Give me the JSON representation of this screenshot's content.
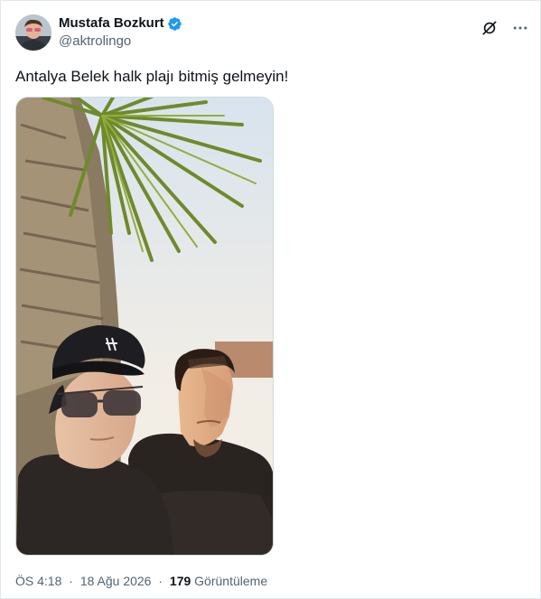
{
  "tweet": {
    "author": {
      "display_name": "Mustafa Bozkurt",
      "handle": "@aktrolingo",
      "verified": true,
      "verified_color": "#1d9bf0"
    },
    "text": "Antalya Belek halk plajı bitmiş gelmeyin!",
    "meta": {
      "time": "ÖS 4:18",
      "date": "18 Ağu 2026",
      "views_count": "179",
      "views_label": "Görüntüleme",
      "separator": "·"
    },
    "icons": [
      "verified-badge-icon",
      "grok-icon",
      "more-icon"
    ]
  },
  "colors": {
    "text_primary": "#0f1419",
    "text_secondary": "#536471",
    "border": "#e1e8ed"
  }
}
